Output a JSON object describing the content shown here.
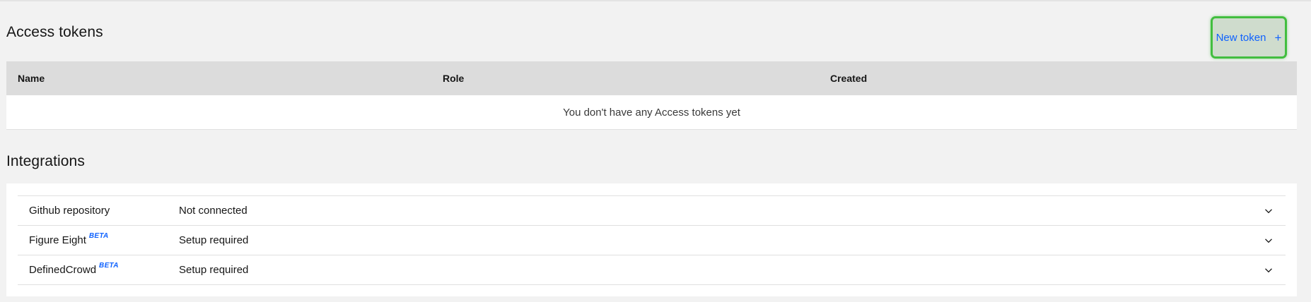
{
  "access_tokens": {
    "title": "Access tokens",
    "new_button": {
      "label": "New token",
      "icon": "plus-icon",
      "icon_glyph": "+"
    },
    "table": {
      "columns": [
        "Name",
        "Role",
        "Created"
      ],
      "empty_message": "You don't have any Access tokens yet"
    }
  },
  "integrations": {
    "title": "Integrations",
    "items": [
      {
        "name": "Github repository",
        "badge": "",
        "status": "Not connected"
      },
      {
        "name": "Figure Eight",
        "badge": "BETA",
        "status": "Setup required"
      },
      {
        "name": "DefinedCrowd",
        "badge": "BETA",
        "status": "Setup required"
      }
    ]
  },
  "colors": {
    "link_blue": "#0f62fe",
    "highlight_green": "#42be3f",
    "header_gray": "#dcdcdc",
    "background": "#f2f2f2"
  }
}
